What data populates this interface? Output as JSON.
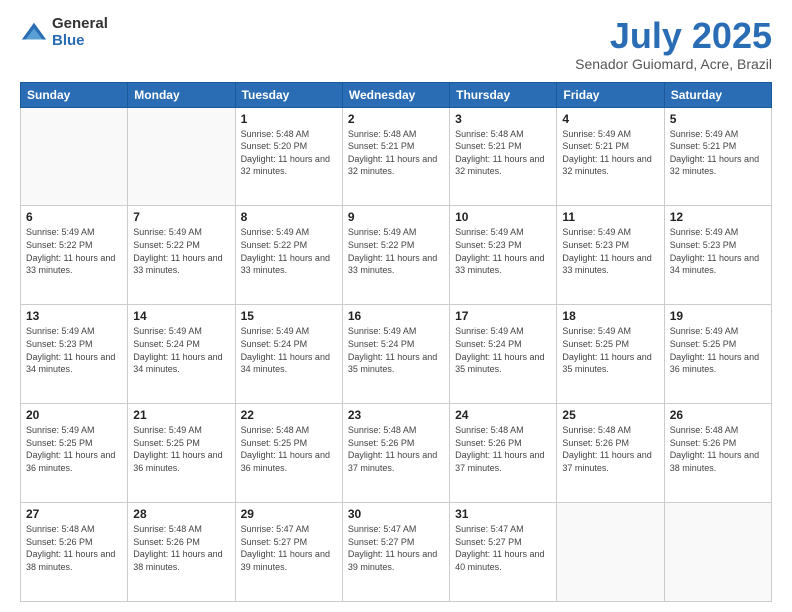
{
  "logo": {
    "general": "General",
    "blue": "Blue"
  },
  "header": {
    "title": "July 2025",
    "subtitle": "Senador Guiomard, Acre, Brazil"
  },
  "days_of_week": [
    "Sunday",
    "Monday",
    "Tuesday",
    "Wednesday",
    "Thursday",
    "Friday",
    "Saturday"
  ],
  "weeks": [
    [
      {
        "day": "",
        "sunrise": "",
        "sunset": "",
        "daylight": ""
      },
      {
        "day": "",
        "sunrise": "",
        "sunset": "",
        "daylight": ""
      },
      {
        "day": "1",
        "sunrise": "Sunrise: 5:48 AM",
        "sunset": "Sunset: 5:20 PM",
        "daylight": "Daylight: 11 hours and 32 minutes."
      },
      {
        "day": "2",
        "sunrise": "Sunrise: 5:48 AM",
        "sunset": "Sunset: 5:21 PM",
        "daylight": "Daylight: 11 hours and 32 minutes."
      },
      {
        "day": "3",
        "sunrise": "Sunrise: 5:48 AM",
        "sunset": "Sunset: 5:21 PM",
        "daylight": "Daylight: 11 hours and 32 minutes."
      },
      {
        "day": "4",
        "sunrise": "Sunrise: 5:49 AM",
        "sunset": "Sunset: 5:21 PM",
        "daylight": "Daylight: 11 hours and 32 minutes."
      },
      {
        "day": "5",
        "sunrise": "Sunrise: 5:49 AM",
        "sunset": "Sunset: 5:21 PM",
        "daylight": "Daylight: 11 hours and 32 minutes."
      }
    ],
    [
      {
        "day": "6",
        "sunrise": "Sunrise: 5:49 AM",
        "sunset": "Sunset: 5:22 PM",
        "daylight": "Daylight: 11 hours and 33 minutes."
      },
      {
        "day": "7",
        "sunrise": "Sunrise: 5:49 AM",
        "sunset": "Sunset: 5:22 PM",
        "daylight": "Daylight: 11 hours and 33 minutes."
      },
      {
        "day": "8",
        "sunrise": "Sunrise: 5:49 AM",
        "sunset": "Sunset: 5:22 PM",
        "daylight": "Daylight: 11 hours and 33 minutes."
      },
      {
        "day": "9",
        "sunrise": "Sunrise: 5:49 AM",
        "sunset": "Sunset: 5:22 PM",
        "daylight": "Daylight: 11 hours and 33 minutes."
      },
      {
        "day": "10",
        "sunrise": "Sunrise: 5:49 AM",
        "sunset": "Sunset: 5:23 PM",
        "daylight": "Daylight: 11 hours and 33 minutes."
      },
      {
        "day": "11",
        "sunrise": "Sunrise: 5:49 AM",
        "sunset": "Sunset: 5:23 PM",
        "daylight": "Daylight: 11 hours and 33 minutes."
      },
      {
        "day": "12",
        "sunrise": "Sunrise: 5:49 AM",
        "sunset": "Sunset: 5:23 PM",
        "daylight": "Daylight: 11 hours and 34 minutes."
      }
    ],
    [
      {
        "day": "13",
        "sunrise": "Sunrise: 5:49 AM",
        "sunset": "Sunset: 5:23 PM",
        "daylight": "Daylight: 11 hours and 34 minutes."
      },
      {
        "day": "14",
        "sunrise": "Sunrise: 5:49 AM",
        "sunset": "Sunset: 5:24 PM",
        "daylight": "Daylight: 11 hours and 34 minutes."
      },
      {
        "day": "15",
        "sunrise": "Sunrise: 5:49 AM",
        "sunset": "Sunset: 5:24 PM",
        "daylight": "Daylight: 11 hours and 34 minutes."
      },
      {
        "day": "16",
        "sunrise": "Sunrise: 5:49 AM",
        "sunset": "Sunset: 5:24 PM",
        "daylight": "Daylight: 11 hours and 35 minutes."
      },
      {
        "day": "17",
        "sunrise": "Sunrise: 5:49 AM",
        "sunset": "Sunset: 5:24 PM",
        "daylight": "Daylight: 11 hours and 35 minutes."
      },
      {
        "day": "18",
        "sunrise": "Sunrise: 5:49 AM",
        "sunset": "Sunset: 5:25 PM",
        "daylight": "Daylight: 11 hours and 35 minutes."
      },
      {
        "day": "19",
        "sunrise": "Sunrise: 5:49 AM",
        "sunset": "Sunset: 5:25 PM",
        "daylight": "Daylight: 11 hours and 36 minutes."
      }
    ],
    [
      {
        "day": "20",
        "sunrise": "Sunrise: 5:49 AM",
        "sunset": "Sunset: 5:25 PM",
        "daylight": "Daylight: 11 hours and 36 minutes."
      },
      {
        "day": "21",
        "sunrise": "Sunrise: 5:49 AM",
        "sunset": "Sunset: 5:25 PM",
        "daylight": "Daylight: 11 hours and 36 minutes."
      },
      {
        "day": "22",
        "sunrise": "Sunrise: 5:48 AM",
        "sunset": "Sunset: 5:25 PM",
        "daylight": "Daylight: 11 hours and 36 minutes."
      },
      {
        "day": "23",
        "sunrise": "Sunrise: 5:48 AM",
        "sunset": "Sunset: 5:26 PM",
        "daylight": "Daylight: 11 hours and 37 minutes."
      },
      {
        "day": "24",
        "sunrise": "Sunrise: 5:48 AM",
        "sunset": "Sunset: 5:26 PM",
        "daylight": "Daylight: 11 hours and 37 minutes."
      },
      {
        "day": "25",
        "sunrise": "Sunrise: 5:48 AM",
        "sunset": "Sunset: 5:26 PM",
        "daylight": "Daylight: 11 hours and 37 minutes."
      },
      {
        "day": "26",
        "sunrise": "Sunrise: 5:48 AM",
        "sunset": "Sunset: 5:26 PM",
        "daylight": "Daylight: 11 hours and 38 minutes."
      }
    ],
    [
      {
        "day": "27",
        "sunrise": "Sunrise: 5:48 AM",
        "sunset": "Sunset: 5:26 PM",
        "daylight": "Daylight: 11 hours and 38 minutes."
      },
      {
        "day": "28",
        "sunrise": "Sunrise: 5:48 AM",
        "sunset": "Sunset: 5:26 PM",
        "daylight": "Daylight: 11 hours and 38 minutes."
      },
      {
        "day": "29",
        "sunrise": "Sunrise: 5:47 AM",
        "sunset": "Sunset: 5:27 PM",
        "daylight": "Daylight: 11 hours and 39 minutes."
      },
      {
        "day": "30",
        "sunrise": "Sunrise: 5:47 AM",
        "sunset": "Sunset: 5:27 PM",
        "daylight": "Daylight: 11 hours and 39 minutes."
      },
      {
        "day": "31",
        "sunrise": "Sunrise: 5:47 AM",
        "sunset": "Sunset: 5:27 PM",
        "daylight": "Daylight: 11 hours and 40 minutes."
      },
      {
        "day": "",
        "sunrise": "",
        "sunset": "",
        "daylight": ""
      },
      {
        "day": "",
        "sunrise": "",
        "sunset": "",
        "daylight": ""
      }
    ]
  ]
}
